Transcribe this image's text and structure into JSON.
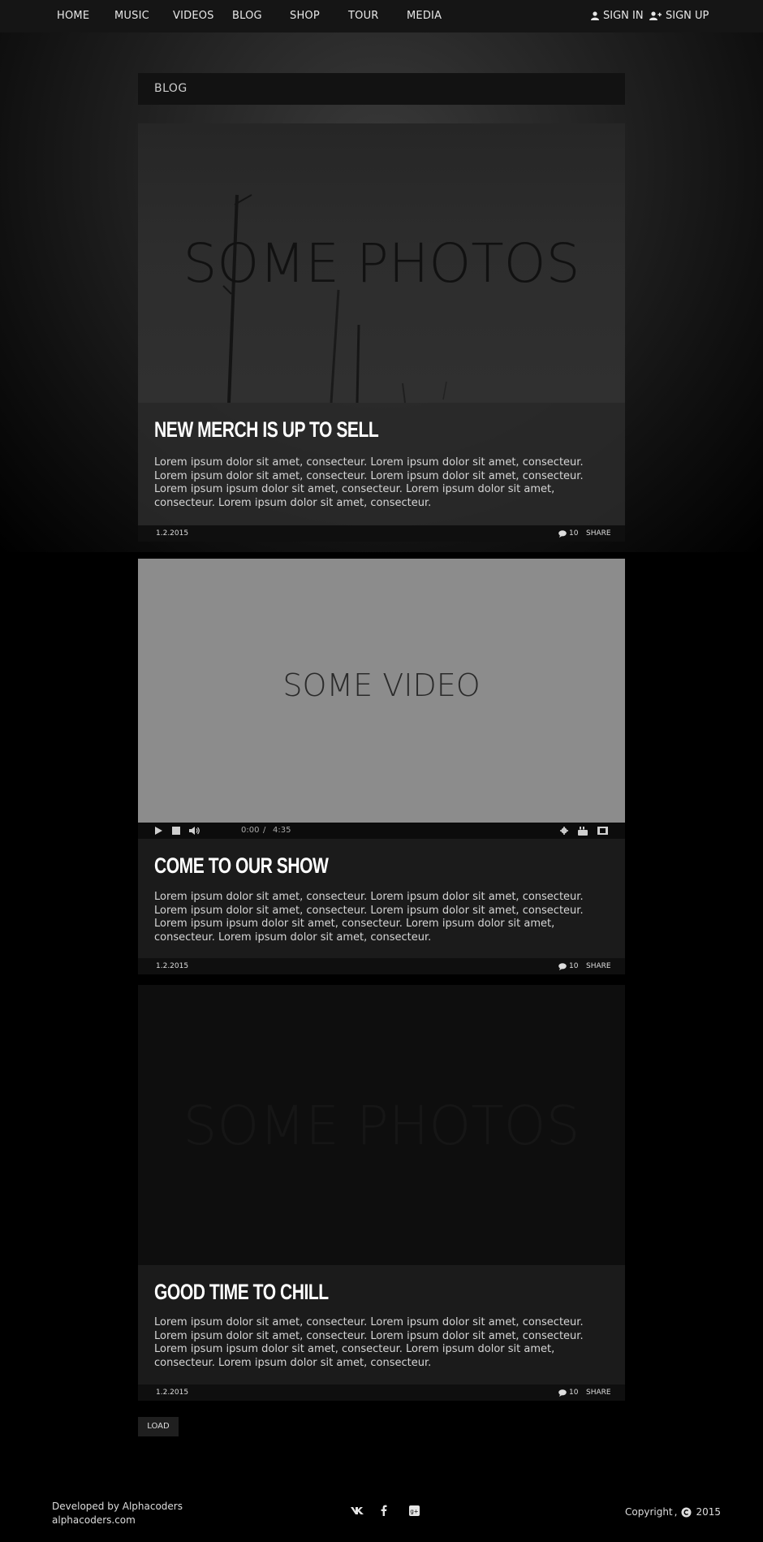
{
  "nav": {
    "items": [
      "HOME",
      "MUSIC",
      "VIDEOS",
      "BLOG",
      "SHOP",
      "TOUR",
      "MEDIA"
    ],
    "sign_in": "SIGN IN",
    "sign_up": "SIGN UP"
  },
  "blog": {
    "heading": "BLOG"
  },
  "posts": [
    {
      "media_label": "SOME PHOTOS",
      "title": "NEW MERCH IS UP TO SELL",
      "text": "Lorem ipsum dolor sit amet, consecteur. Lorem ipsum dolor sit amet, consecteur. Lorem ipsum dolor sit amet, consecteur. Lorem ipsum dolor sit amet, consecteur. Lorem ipsum ipsum dolor sit amet, consecteur. Lorem ipsum dolor sit amet, consecteur. Lorem ipsum dolor sit amet, consecteur.",
      "date": "1.2.2015",
      "comments": "10",
      "share": "SHARE"
    },
    {
      "media_label": "SOME VIDEO",
      "title": "COME TO OUR SHOW",
      "text": "Lorem ipsum dolor sit amet, consecteur. Lorem ipsum dolor sit amet, consecteur. Lorem ipsum dolor sit amet, consecteur. Lorem ipsum dolor sit amet, consecteur. Lorem ipsum ipsum dolor sit amet, consecteur. Lorem ipsum dolor sit amet, consecteur. Lorem ipsum dolor sit amet, consecteur.",
      "date": "1.2.2015",
      "comments": "10",
      "share": "SHARE"
    },
    {
      "media_label": "SOME PHOTOS",
      "title": "GOOD TIME TO CHILL",
      "text": "Lorem ipsum dolor sit amet, consecteur. Lorem ipsum dolor sit amet, consecteur. Lorem ipsum dolor sit amet, consecteur. Lorem ipsum dolor sit amet, consecteur. Lorem ipsum ipsum dolor sit amet, consecteur. Lorem ipsum dolor sit amet, consecteur. Lorem ipsum dolor sit amet, consecteur.",
      "date": "1.2.2015",
      "comments": "10",
      "share": "SHARE"
    }
  ],
  "video": {
    "current_time": "0:00",
    "separator": "/",
    "duration": "4:35",
    "icons": [
      "play-icon",
      "stop-icon",
      "volume-icon",
      "gear-icon",
      "youtube-icon",
      "fullscreen-icon"
    ]
  },
  "load": {
    "label": "LOAD"
  },
  "footer": {
    "developed_by": "Developed by Alphacoders",
    "site": "alphacoders.com",
    "social_icons": [
      "vk-icon",
      "facebook-icon",
      "google-plus-icon"
    ],
    "copyright": "Copyright",
    "year": "2015"
  },
  "colors": {
    "nav_bg": "#151515",
    "panel_bg": "#1b1b1b",
    "video_placeholder": "#8c8c8c",
    "page_bg": "#000000"
  }
}
